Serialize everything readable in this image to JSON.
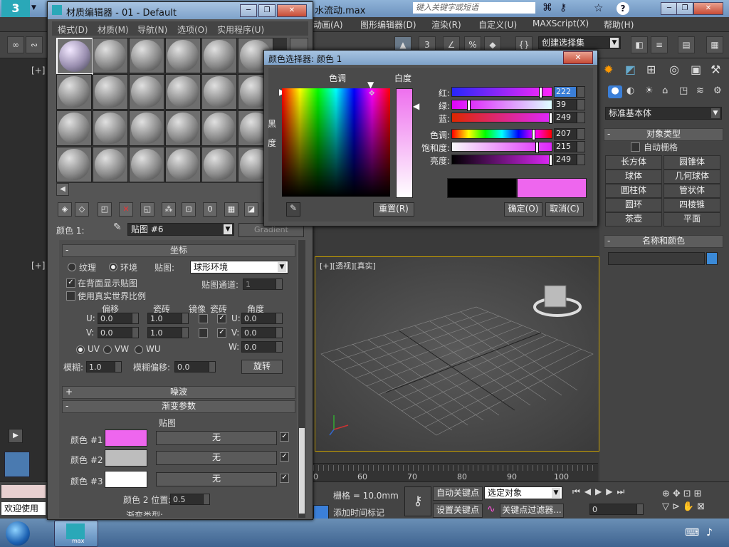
{
  "app": {
    "logo": "3",
    "title_tail": "水流动.max",
    "search_placeholder": "键入关键字或短语",
    "menus": [
      "动画(A)",
      "图形编辑器(D)",
      "渲染(R)",
      "自定义(U)",
      "MAXScript(X)",
      "帮助(H)"
    ],
    "selection_set": "创建选择集",
    "left_viewport_label": "[+]",
    "left_viewport_label2": "[+]",
    "persp_label": "[+][透视][真实]"
  },
  "material_editor": {
    "title": "材质编辑器 - 01 - Default",
    "menus": [
      "模式(D)",
      "材质(M)",
      "导航(N)",
      "选项(O)",
      "实用程序(U)"
    ],
    "color_label": "颜色 1:",
    "map_name": "贴图 #6",
    "map_type": "Gradient",
    "coords": {
      "header": "坐标",
      "texture": "纹理",
      "environ": "环境",
      "map_label": "贴图:",
      "map_value": "球形环境",
      "show_back": "在背面显示贴图",
      "real_world": "使用真实世界比例",
      "channel_label": "贴图通道:",
      "channel_value": "1",
      "offset": "偏移",
      "tiling": "瓷砖",
      "mirror": "镜像",
      "tile": "瓷砖",
      "angle": "角度",
      "u_label": "U:",
      "v_label": "V:",
      "w_label": "W:",
      "u_offset": "0.0",
      "v_offset": "0.0",
      "u_tiling": "1.0",
      "v_tiling": "1.0",
      "u_angle": "0.0",
      "v_angle": "0.0",
      "w_angle": "0.0",
      "uv": "UV",
      "vw": "VW",
      "wu": "WU",
      "blur_label": "模糊:",
      "blur_value": "1.0",
      "blur_offset_label": "模糊偏移:",
      "blur_offset_value": "0.0",
      "rotate": "旋转"
    },
    "noise_header": "噪波",
    "gradient": {
      "header": "渐变参数",
      "map_col": "贴图",
      "color1": "颜色 #1",
      "color2": "颜色 #2",
      "color3": "颜色 #3",
      "none1": "无",
      "none2": "无",
      "none3": "无",
      "pos_label": "颜色 2 位置:",
      "pos_value": "0.5",
      "type_label": "渐变类型:"
    }
  },
  "color_picker": {
    "title": "颜色选择器: 颜色 1",
    "hue_label": "色调",
    "white_label": "白度",
    "black_label_1": "黑",
    "black_label_2": "度",
    "red_label": "红:",
    "green_label": "绿:",
    "blue_label": "蓝:",
    "hue2_label": "色调:",
    "sat_label": "饱和度:",
    "val_label": "亮度:",
    "red": 222,
    "green": 39,
    "blue": 249,
    "hue": 207,
    "sat": 215,
    "value": 249,
    "reset": "重置(R)",
    "ok": "确定(O)",
    "cancel": "取消(C)"
  },
  "command_panel": {
    "dropdown": "标准基本体",
    "object_type": "对象类型",
    "auto_grid": "自动栅格",
    "buttons": [
      "长方体",
      "圆锥体",
      "球体",
      "几何球体",
      "圆柱体",
      "管状体",
      "圆环",
      "四棱锥",
      "茶壶",
      "平面"
    ],
    "name_color": "名称和颜色"
  },
  "timeline": {
    "ticks": [
      "60",
      "70",
      "80",
      "90",
      "100"
    ],
    "tick0": "0"
  },
  "status": {
    "welcome": "欢迎使用",
    "grid": "栅格 = 10.0mm",
    "auto_key": "自动关键点",
    "selected": "选定对象",
    "set_key": "设置关键点",
    "key_filter": "关键点过滤器...",
    "add_time_tag": "添加时间标记",
    "frame": "0"
  },
  "taskbar": {
    "app_label": "max"
  },
  "colors": {
    "accent_pink": "#ee66ee",
    "gray_swatch": "#bdbdbd",
    "white_swatch": "#ffffff"
  }
}
